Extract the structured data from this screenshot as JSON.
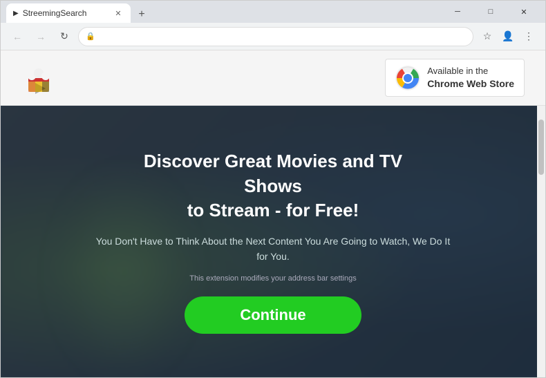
{
  "browser": {
    "tab": {
      "title": "StreemingSearch",
      "favicon": "▶"
    },
    "new_tab_label": "+",
    "window_controls": {
      "minimize": "─",
      "maximize": "□",
      "close": "✕"
    },
    "nav": {
      "back_label": "←",
      "forward_label": "→",
      "reload_label": "↻",
      "address": "",
      "lock_icon": "🔒",
      "star_label": "☆",
      "account_label": "👤",
      "menu_label": "⋮"
    }
  },
  "header": {
    "chrome_store_line1": "Available in the",
    "chrome_store_line2": "Chrome Web Store"
  },
  "hero": {
    "title_line1": "Discover Great Movies and TV",
    "title_line2": "Shows",
    "title_line3": "to Stream - ",
    "title_bold": "for Free!",
    "subtitle": "You Don't Have to Think About the Next Content You Are Going to Watch, We Do It for You.",
    "disclaimer": "This extension modifies your address bar settings",
    "cta_button": "Continue"
  }
}
